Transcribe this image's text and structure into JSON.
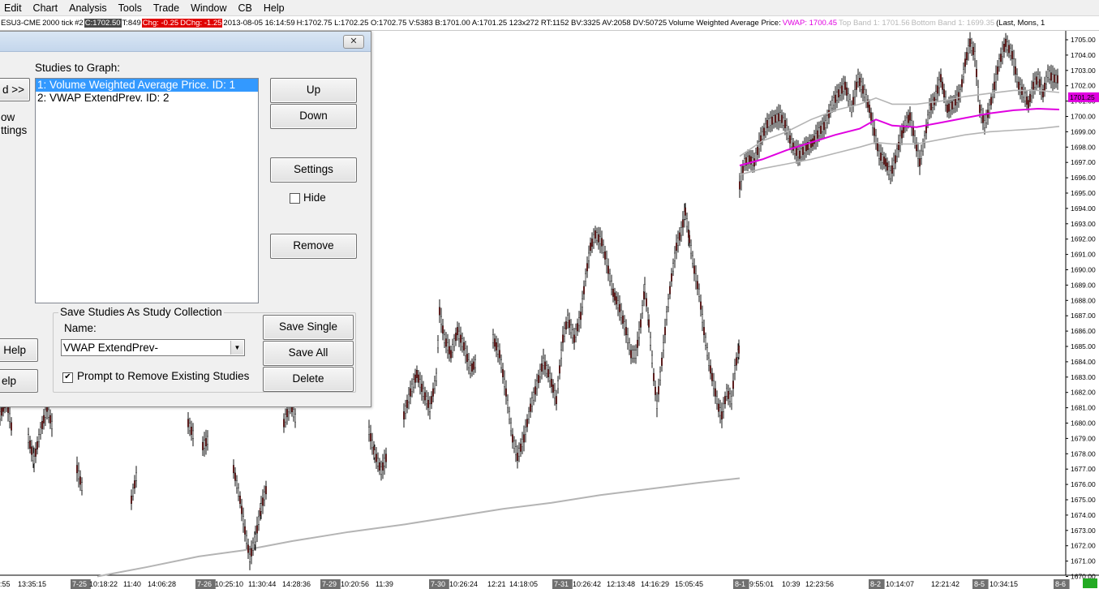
{
  "menu": [
    "Edit",
    "Chart",
    "Analysis",
    "Tools",
    "Trade",
    "Window",
    "CB",
    "Help"
  ],
  "infobar": {
    "symbol": "ESU3-CME",
    "period": "2000 tick",
    "chart_no": "#2",
    "close": "C:1702.50",
    "trades": "T:849",
    "chg": "Chg: -0.25",
    "dchg": "DChg: -1.25",
    "datetime": "2013-08-05 16:14:59",
    "ohlc": "H:1702.75 L:1702.25 O:1702.75 V:5383 B:1701.00 A:1701.25 123x272 RT:1152 BV:3325 AV:2058 DV:50725",
    "study": "Volume Weighted Average Price:",
    "vwap": "VWAP: 1700.45",
    "top_band": "Top Band 1: 1701.56",
    "bottom_band": "Bottom Band 1: 1699.35",
    "tail": "(Last, Mons, 1"
  },
  "dialog": {
    "studies_label": "Studies to Graph:",
    "left_partial_button": "d >>",
    "left_partial_text_1": "ow",
    "left_partial_text_2": "ttings",
    "left_partial_help_1": "s Help",
    "left_partial_help_2": "elp",
    "studies": [
      "1: Volume Weighted Average Price. ID: 1",
      "2: VWAP ExtendPrev. ID: 2"
    ],
    "up": "Up",
    "down": "Down",
    "settings": "Settings",
    "hide": "Hide",
    "remove": "Remove",
    "group_title": "Save Studies As Study Collection",
    "name_label": "Name:",
    "name_value": "VWAP ExtendPrev-",
    "save_single": "Save Single",
    "save_all": "Save All",
    "delete": "Delete",
    "prompt": "Prompt to Remove Existing Studies",
    "close_glyph": "✕"
  },
  "price_label": "1701.25",
  "colors": {
    "vwap": "#e000e0",
    "bands": "#b4b4b4",
    "candle_down": "#8b1a1a",
    "price_label_bg": "#e000e0"
  },
  "chart_data": {
    "type": "line",
    "y_ticks": [
      "1705.00",
      "1704.00",
      "1703.00",
      "1702.00",
      "1701.00",
      "1700.00",
      "1699.00",
      "1698.00",
      "1697.00",
      "1696.00",
      "1695.00",
      "1694.00",
      "1693.00",
      "1692.00",
      "1691.00",
      "1690.00",
      "1689.00",
      "1688.00",
      "1687.00",
      "1686.00",
      "1685.00",
      "1684.00",
      "1683.00",
      "1682.00",
      "1681.00",
      "1680.00",
      "1679.00",
      "1678.00",
      "1677.00",
      "1676.00",
      "1675.00",
      "1674.00",
      "1673.00",
      "1672.00",
      "1671.00",
      "1670.00"
    ],
    "ylim": [
      1670,
      1705.5
    ],
    "x_labels": [
      {
        "t": ":55",
        "date": false
      },
      {
        "t": "13:35:15",
        "date": false
      },
      {
        "t": "7-25",
        "date": true
      },
      {
        "t": "10:18:22",
        "date": false
      },
      {
        "t": "11:40",
        "date": false
      },
      {
        "t": "14:06:28",
        "date": false
      },
      {
        "t": "7-26",
        "date": true
      },
      {
        "t": "10:25:10",
        "date": false
      },
      {
        "t": "11:30:44",
        "date": false
      },
      {
        "t": "14:28:36",
        "date": false
      },
      {
        "t": "7-29",
        "date": true
      },
      {
        "t": "10:20:56",
        "date": false
      },
      {
        "t": "11:39",
        "date": false
      },
      {
        "t": "7-30",
        "date": true
      },
      {
        "t": "10:26:24",
        "date": false
      },
      {
        "t": "12:21",
        "date": false
      },
      {
        "t": "14:18:05",
        "date": false
      },
      {
        "t": "7-31",
        "date": true
      },
      {
        "t": "10:26:42",
        "date": false
      },
      {
        "t": "12:13:48",
        "date": false
      },
      {
        "t": "14:16:29",
        "date": false
      },
      {
        "t": "15:05:45",
        "date": false
      },
      {
        "t": "8-1",
        "date": true
      },
      {
        "t": "9:55:01",
        "date": false
      },
      {
        "t": "10:39",
        "date": false
      },
      {
        "t": "12:23:56",
        "date": false
      },
      {
        "t": "8-2",
        "date": true
      },
      {
        "t": "10:14:07",
        "date": false
      },
      {
        "t": "12:21:42",
        "date": false
      },
      {
        "t": "8-5",
        "date": true
      },
      {
        "t": "10:34:15",
        "date": false
      },
      {
        "t": "8-6",
        "date": true
      }
    ],
    "price_path": [
      [
        0,
        1680.5
      ],
      [
        8,
        1681.5
      ],
      [
        15,
        1679.5
      ],
      [
        25,
        1681
      ],
      [
        35,
        1679
      ],
      [
        42,
        1677.6
      ],
      [
        50,
        1679.5
      ],
      [
        58,
        1681
      ],
      [
        66,
        1679.5
      ],
      [
        75,
        1681.5
      ],
      [
        85,
        1679.5
      ],
      [
        95,
        1677
      ],
      [
        103,
        1675.5
      ],
      [
        112,
        1678
      ],
      [
        122,
        1679.5
      ],
      [
        132,
        1681
      ],
      [
        142,
        1678
      ],
      [
        152,
        1676.5
      ],
      [
        162,
        1675
      ],
      [
        170,
        1677
      ],
      [
        180,
        1680
      ],
      [
        190,
        1681.5
      ],
      [
        200,
        1680
      ],
      [
        210,
        1681.5
      ],
      [
        220,
        1681
      ],
      [
        232,
        1680
      ],
      [
        240,
        1679
      ],
      [
        250,
        1678.5
      ],
      [
        258,
        1679
      ],
      [
        268,
        1680.5
      ],
      [
        278,
        1679
      ],
      [
        288,
        1677
      ],
      [
        296,
        1675
      ],
      [
        302,
        1673
      ],
      [
        308,
        1671.2
      ],
      [
        315,
        1672.5
      ],
      [
        322,
        1674.5
      ],
      [
        330,
        1676
      ],
      [
        340,
        1678.5
      ],
      [
        350,
        1680
      ],
      [
        358,
        1681.3
      ],
      [
        366,
        1680
      ],
      [
        375,
        1681.5
      ],
      [
        385,
        1681
      ],
      [
        395,
        1682
      ],
      [
        405,
        1681.5
      ],
      [
        415,
        1682
      ],
      [
        425,
        1681.5
      ],
      [
        435,
        1680.5
      ],
      [
        445,
        1681
      ],
      [
        455,
        1679.5
      ],
      [
        462,
        1678
      ],
      [
        470,
        1676.9
      ],
      [
        478,
        1678
      ],
      [
        488,
        1679.5
      ],
      [
        498,
        1680.5
      ],
      [
        506,
        1682
      ],
      [
        514,
        1683.2
      ],
      [
        522,
        1682
      ],
      [
        530,
        1681
      ],
      [
        538,
        1683
      ],
      [
        542,
        1687.3
      ],
      [
        548,
        1685.5
      ],
      [
        556,
        1684.5
      ],
      [
        564,
        1686
      ],
      [
        572,
        1685
      ],
      [
        580,
        1683.5
      ],
      [
        588,
        1684
      ],
      [
        598,
        1685
      ],
      [
        608,
        1685.5
      ],
      [
        616,
        1684.5
      ],
      [
        624,
        1682
      ],
      [
        632,
        1679
      ],
      [
        638,
        1677.8
      ],
      [
        646,
        1679
      ],
      [
        654,
        1681
      ],
      [
        662,
        1682.5
      ],
      [
        670,
        1684
      ],
      [
        678,
        1683
      ],
      [
        686,
        1681.5
      ],
      [
        694,
        1685.5
      ],
      [
        700,
        1686.8
      ],
      [
        708,
        1685.5
      ],
      [
        716,
        1687
      ],
      [
        722,
        1689.5
      ],
      [
        728,
        1691.5
      ],
      [
        734,
        1692.3
      ],
      [
        742,
        1691.8
      ],
      [
        748,
        1690.5
      ],
      [
        756,
        1688.5
      ],
      [
        764,
        1687.5
      ],
      [
        772,
        1686
      ],
      [
        778,
        1684.5
      ],
      [
        784,
        1684.5
      ],
      [
        790,
        1686.5
      ],
      [
        795,
        1688.8
      ],
      [
        800,
        1686.5
      ],
      [
        806,
        1683
      ],
      [
        810,
        1681.2
      ],
      [
        816,
        1684
      ],
      [
        822,
        1687
      ],
      [
        828,
        1689.5
      ],
      [
        834,
        1691.5
      ],
      [
        840,
        1692.5
      ],
      [
        845,
        1693.8
      ],
      [
        850,
        1692
      ],
      [
        856,
        1690
      ],
      [
        862,
        1688.5
      ],
      [
        868,
        1686
      ],
      [
        874,
        1684
      ],
      [
        880,
        1682.5
      ],
      [
        886,
        1681
      ],
      [
        890,
        1680.5
      ],
      [
        896,
        1682
      ],
      [
        902,
        1681.5
      ],
      [
        906,
        1683.5
      ],
      [
        911,
        1684.8
      ],
      [
        912,
        1695.5
      ],
      [
        918,
        1697
      ],
      [
        924,
        1697.2
      ],
      [
        930,
        1697
      ],
      [
        938,
        1698.5
      ],
      [
        946,
        1699.5
      ],
      [
        954,
        1699.8
      ],
      [
        962,
        1700
      ],
      [
        968,
        1699.5
      ],
      [
        974,
        1698.5
      ],
      [
        980,
        1697.8
      ],
      [
        986,
        1697.5
      ],
      [
        994,
        1698
      ],
      [
        1002,
        1698.3
      ],
      [
        1010,
        1699
      ],
      [
        1018,
        1699.5
      ],
      [
        1026,
        1700.8
      ],
      [
        1034,
        1701.5
      ],
      [
        1042,
        1702
      ],
      [
        1050,
        1700.5
      ],
      [
        1058,
        1702.5
      ],
      [
        1066,
        1701.5
      ],
      [
        1072,
        1700.5
      ],
      [
        1078,
        1699
      ],
      [
        1084,
        1697.5
      ],
      [
        1092,
        1697
      ],
      [
        1098,
        1696.2
      ],
      [
        1104,
        1697.2
      ],
      [
        1110,
        1698.5
      ],
      [
        1116,
        1699.5
      ],
      [
        1122,
        1700
      ],
      [
        1128,
        1698.5
      ],
      [
        1134,
        1697
      ],
      [
        1140,
        1698.5
      ],
      [
        1146,
        1700.5
      ],
      [
        1152,
        1701
      ],
      [
        1160,
        1702.5
      ],
      [
        1168,
        1700.5
      ],
      [
        1176,
        1700.8
      ],
      [
        1184,
        1701.5
      ],
      [
        1190,
        1703.5
      ],
      [
        1196,
        1704.8
      ],
      [
        1202,
        1704
      ],
      [
        1208,
        1700.5
      ],
      [
        1214,
        1699.5
      ],
      [
        1220,
        1700.5
      ],
      [
        1226,
        1702
      ],
      [
        1232,
        1703.5
      ],
      [
        1240,
        1704.8
      ],
      [
        1248,
        1704
      ],
      [
        1256,
        1702
      ],
      [
        1262,
        1701.5
      ],
      [
        1268,
        1700.8
      ],
      [
        1274,
        1702
      ],
      [
        1280,
        1702.5
      ],
      [
        1286,
        1701.5
      ],
      [
        1292,
        1702.8
      ],
      [
        1298,
        1702.5
      ],
      [
        1306,
        1702.4
      ]
    ],
    "vwap_path": [
      [
        912,
        1696.8
      ],
      [
        940,
        1697.2
      ],
      [
        970,
        1697.8
      ],
      [
        1000,
        1698.3
      ],
      [
        1030,
        1698.8
      ],
      [
        1060,
        1699.2
      ],
      [
        1080,
        1699.8
      ],
      [
        1100,
        1699.4
      ],
      [
        1130,
        1699.3
      ],
      [
        1160,
        1699.6
      ],
      [
        1190,
        1699.9
      ],
      [
        1220,
        1700.2
      ],
      [
        1250,
        1700.4
      ],
      [
        1280,
        1700.5
      ],
      [
        1306,
        1700.45
      ]
    ],
    "top_band_path": [
      [
        912,
        1697.4
      ],
      [
        940,
        1698.4
      ],
      [
        970,
        1699
      ],
      [
        1000,
        1699.8
      ],
      [
        1030,
        1700.4
      ],
      [
        1060,
        1700.8
      ],
      [
        1080,
        1701.2
      ],
      [
        1100,
        1700.8
      ],
      [
        1130,
        1700.8
      ],
      [
        1160,
        1701
      ],
      [
        1190,
        1701.3
      ],
      [
        1220,
        1701.5
      ],
      [
        1250,
        1701.7
      ],
      [
        1280,
        1701.7
      ],
      [
        1306,
        1701.56
      ]
    ],
    "bottom_band_path": [
      [
        912,
        1696.2
      ],
      [
        940,
        1696.6
      ],
      [
        970,
        1696.9
      ],
      [
        1000,
        1697.2
      ],
      [
        1030,
        1697.6
      ],
      [
        1060,
        1698
      ],
      [
        1080,
        1698.3
      ],
      [
        1100,
        1698.2
      ],
      [
        1130,
        1698.2
      ],
      [
        1160,
        1698.5
      ],
      [
        1190,
        1698.8
      ],
      [
        1220,
        1699
      ],
      [
        1250,
        1699.1
      ],
      [
        1280,
        1699.2
      ],
      [
        1306,
        1699.35
      ]
    ],
    "extend_prev_path": [
      [
        120,
        1670
      ],
      [
        180,
        1670.6
      ],
      [
        245,
        1671.3
      ],
      [
        300,
        1671.7
      ],
      [
        360,
        1672.3
      ],
      [
        430,
        1672.9
      ],
      [
        500,
        1673.4
      ],
      [
        560,
        1673.9
      ],
      [
        620,
        1674.4
      ],
      [
        680,
        1674.8
      ],
      [
        740,
        1675.3
      ],
      [
        800,
        1675.7
      ],
      [
        860,
        1676.1
      ],
      [
        912,
        1676.4
      ]
    ]
  }
}
